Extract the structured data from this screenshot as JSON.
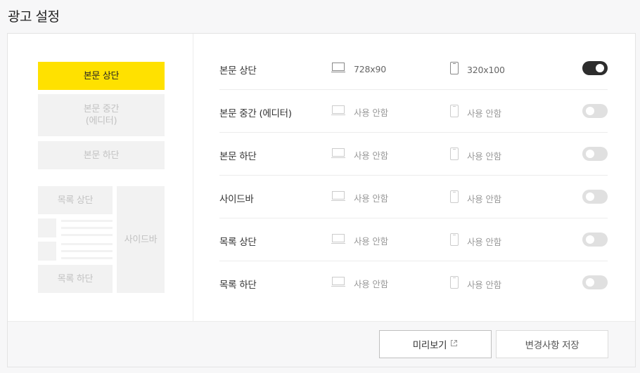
{
  "page": {
    "title": "광고 설정"
  },
  "preview": {
    "top": "본문 상단",
    "middle_line1": "본문 중간",
    "middle_line2": "(에디터)",
    "bottom": "본문 하단",
    "list_top": "목록 상단",
    "list_bottom": "목록 하단",
    "sidebar": "사이드바",
    "active_color": "#ffe100"
  },
  "rows": [
    {
      "label": "본문 상단",
      "pc": "728x90",
      "mobile": "320x100",
      "enabled": true
    },
    {
      "label": "본문 중간 (에디터)",
      "pc": "사용 안함",
      "mobile": "사용 안함",
      "enabled": false
    },
    {
      "label": "본문 하단",
      "pc": "사용 안함",
      "mobile": "사용 안함",
      "enabled": false
    },
    {
      "label": "사이드바",
      "pc": "사용 안함",
      "mobile": "사용 안함",
      "enabled": false
    },
    {
      "label": "목록 상단",
      "pc": "사용 안함",
      "mobile": "사용 안함",
      "enabled": false
    },
    {
      "label": "목록 하단",
      "pc": "사용 안함",
      "mobile": "사용 안함",
      "enabled": false
    }
  ],
  "footer": {
    "preview_label": "미리보기",
    "save_label": "변경사항 저장"
  }
}
